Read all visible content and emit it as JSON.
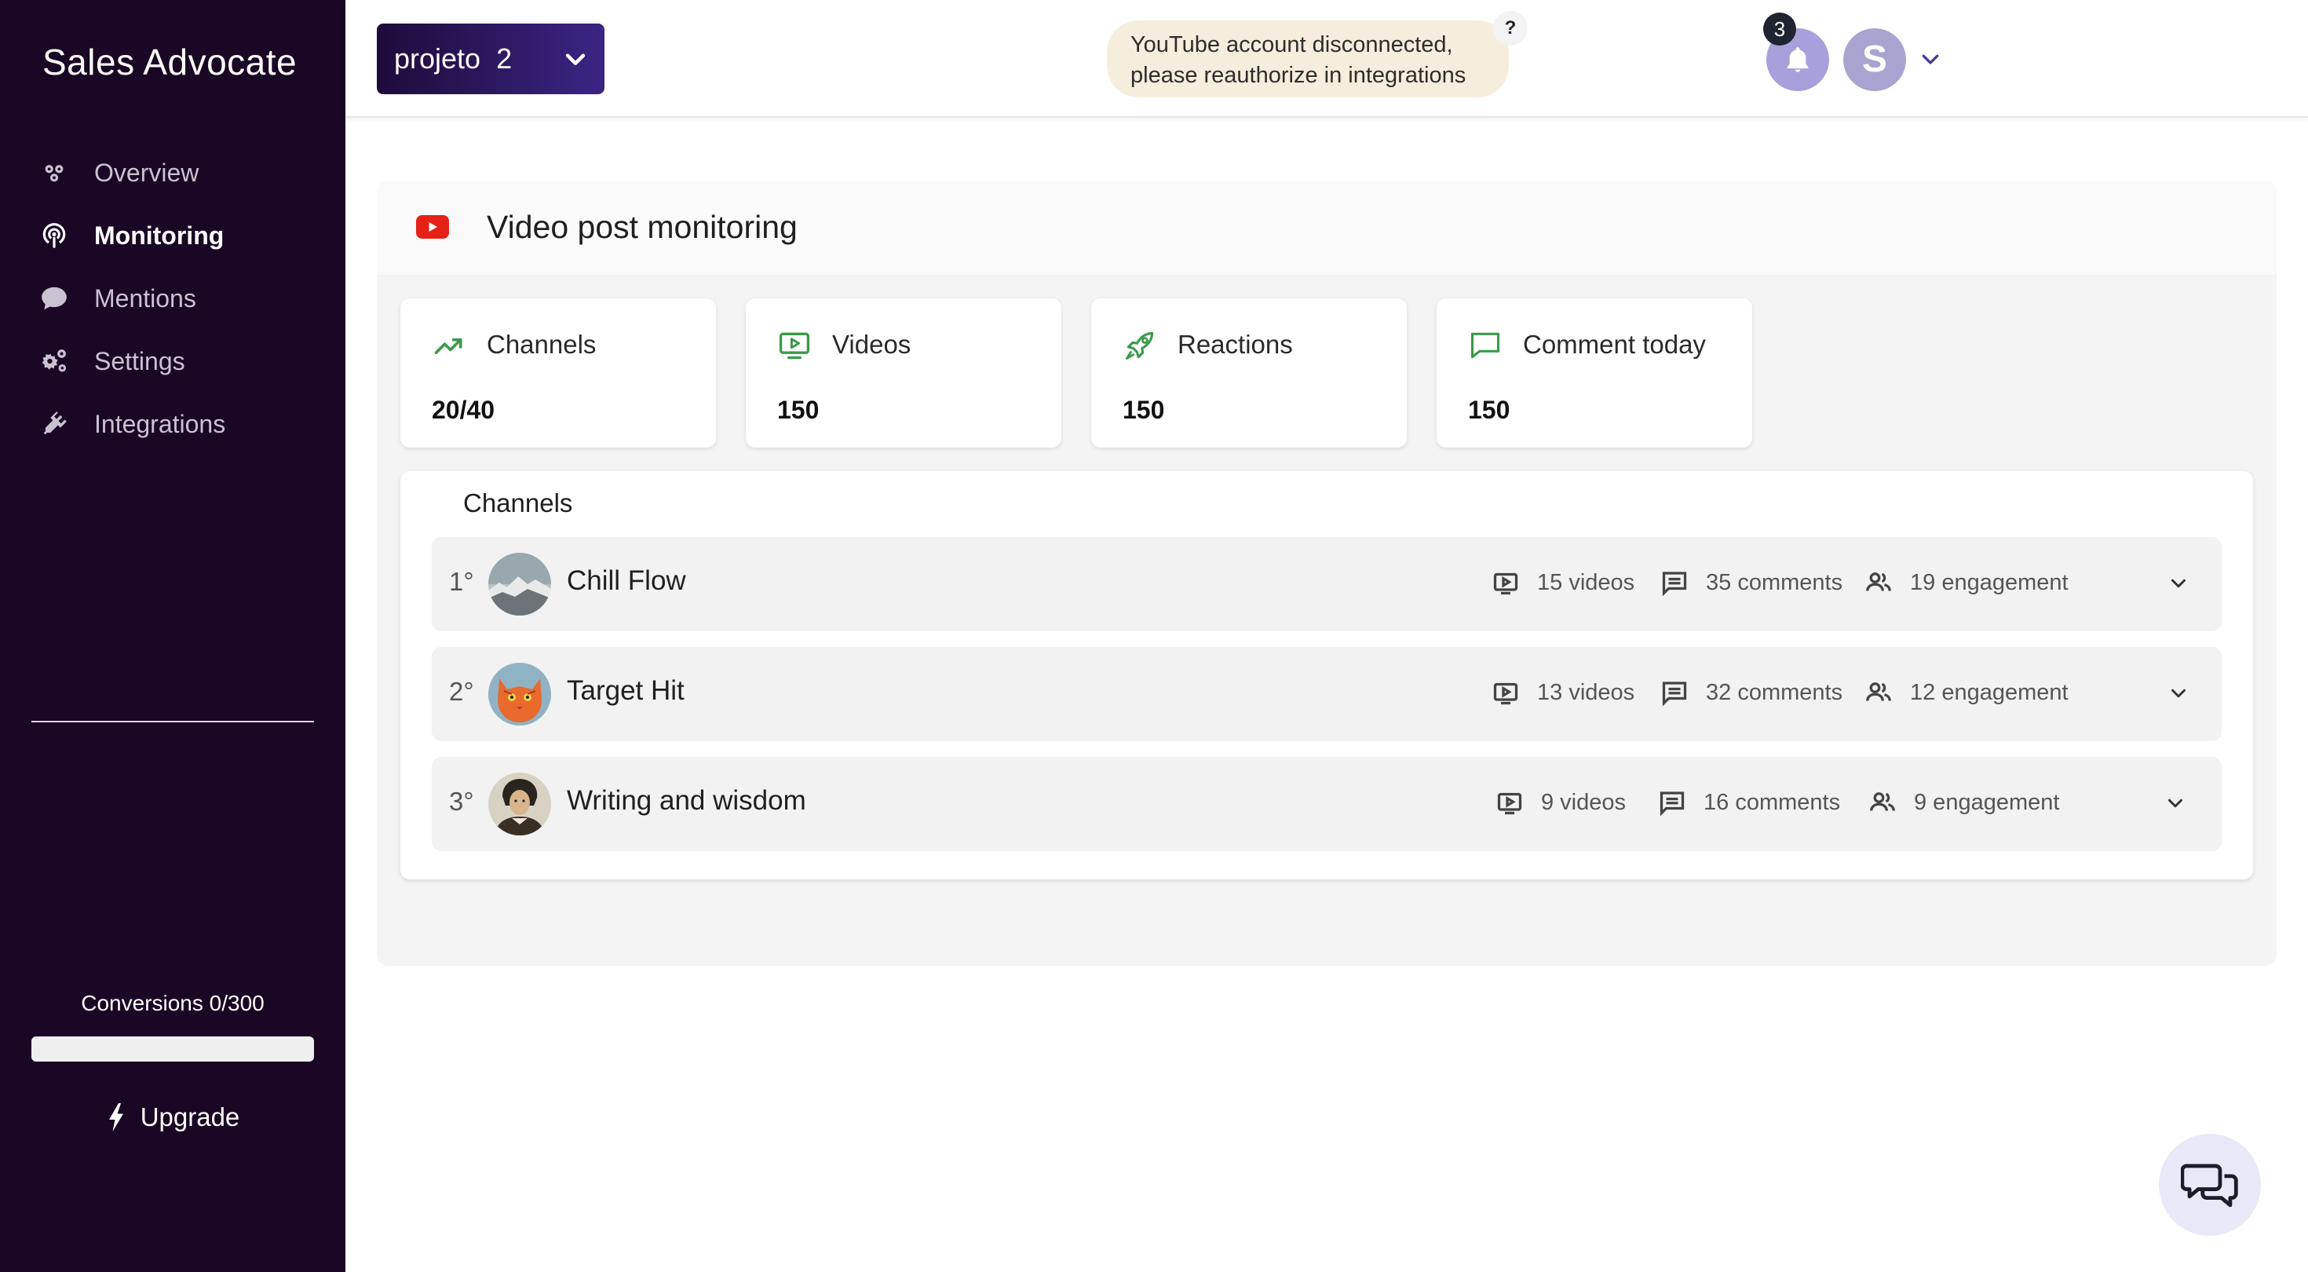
{
  "sidebar": {
    "brand": "Sales Advocate",
    "items": [
      {
        "label": "Overview",
        "icon": "overview-icon"
      },
      {
        "label": "Monitoring",
        "icon": "monitoring-icon",
        "active": true
      },
      {
        "label": "Mentions",
        "icon": "chat-bubble-icon"
      },
      {
        "label": "Settings",
        "icon": "gears-icon"
      },
      {
        "label": "Integrations",
        "icon": "plug-icon"
      }
    ],
    "conversions_label": "Conversions 0/300",
    "conversions_progress": 0,
    "upgrade_label": "Upgrade"
  },
  "topbar": {
    "project_name": "projeto  2",
    "alert_text": "YouTube account disconnected, please reauthorize in integrations",
    "alert_help": "?",
    "notification_count": "3",
    "avatar_initial": "S"
  },
  "main": {
    "title": "Video post monitoring",
    "cards": [
      {
        "label": "Channels",
        "value": "20/40",
        "icon": "trending-up-icon"
      },
      {
        "label": "Videos",
        "value": "150",
        "icon": "video-screen-icon"
      },
      {
        "label": "Reactions",
        "value": "150",
        "icon": "rocket-icon"
      },
      {
        "label": "Comment today",
        "value": "150",
        "icon": "comment-icon"
      }
    ],
    "channels_title": "Channels",
    "channels": [
      {
        "rank": "1°",
        "name": "Chill Flow",
        "videos": "15 videos",
        "comments": "35 comments",
        "engagement": "19 engagement"
      },
      {
        "rank": "2°",
        "name": "Target Hit",
        "videos": "13 videos",
        "comments": "32 comments",
        "engagement": "12 engagement"
      },
      {
        "rank": "3°",
        "name": "Writing and wisdom",
        "videos": "9 videos",
        "comments": "16 comments",
        "engagement": "9 engagement"
      }
    ]
  },
  "colors": {
    "sidebar_bg": "#1a0625",
    "accent_green": "#3a9a4a",
    "youtube_red": "#e62117",
    "bell_bg": "#a7a0dc"
  }
}
